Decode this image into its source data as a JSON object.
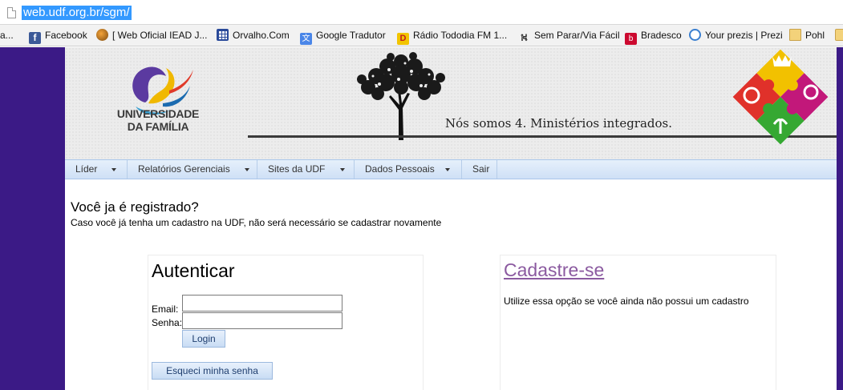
{
  "browser": {
    "url": "web.udf.org.br/sgm/",
    "bookmarks": [
      {
        "label": "a...",
        "icon": "none"
      },
      {
        "label": "Facebook",
        "icon": "facebook-icon"
      },
      {
        "label": "[ Web Oficial IEAD J...",
        "icon": "iead-icon"
      },
      {
        "label": "Orvalho.Com",
        "icon": "grid-icon"
      },
      {
        "label": "Google Tradutor",
        "icon": "translate-icon"
      },
      {
        "label": "Rádio Tododia FM 1...",
        "icon": "radio-icon"
      },
      {
        "label": "Sem Parar/Via Fácil",
        "icon": "road-icon"
      },
      {
        "label": "Bradesco",
        "icon": "bradesco-icon"
      },
      {
        "label": "Your prezis | Prezi",
        "icon": "prezi-icon"
      },
      {
        "label": "Pohl",
        "icon": "folder-icon"
      },
      {
        "label": "",
        "icon": "folder-icon"
      }
    ]
  },
  "header": {
    "logo_line1": "UNIVERSIDADE",
    "logo_line2": "DA FAMÍLIA",
    "slogan": "Nós somos 4. Ministérios integrados."
  },
  "nav": {
    "items": [
      "Líder",
      "Relatórios Gerenciais",
      "Sites da UDF",
      "Dados Pessoais",
      "Sair"
    ]
  },
  "registered": {
    "title": "Você ja é registrado?",
    "subtitle": "Caso você já tenha um cadastro na UDF, não será necessário se cadastrar novamente"
  },
  "auth": {
    "title": "Autenticar",
    "email_label": "Email:",
    "senha_label": "Senha:",
    "email_value": "",
    "senha_value": "",
    "login_label": "Login",
    "forgot_label": "Esqueci minha senha"
  },
  "signup": {
    "title": "Cadastre-se",
    "description": "Utilize essa opção se você ainda não possui um cadastro"
  },
  "colors": {
    "sidebar": "#3b1a86",
    "selection": "#3399ff",
    "link": "#8b5aa0",
    "nav": "#cfe0f6"
  }
}
